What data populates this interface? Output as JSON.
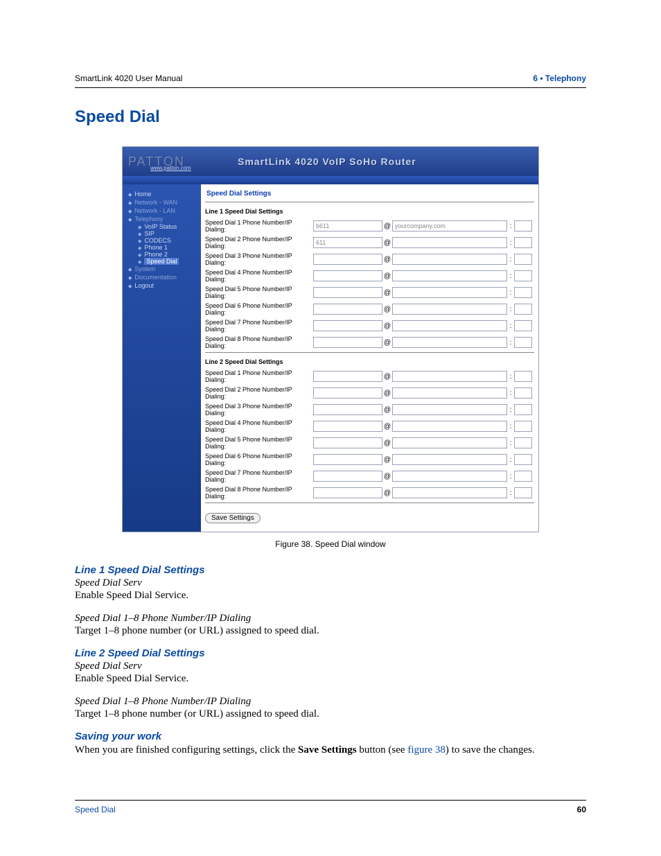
{
  "header": {
    "left": "SmartLink 4020 User Manual",
    "right": "6 • Telephony"
  },
  "page_title": "Speed Dial",
  "screenshot": {
    "brand": "PATTON",
    "brand_url": "www.patton.com",
    "banner_title": "SmartLink 4020 VoIP SoHo Router",
    "nav": {
      "home": "Home",
      "wan": "Network - WAN",
      "lan": "Network - LAN",
      "telephony": "Telephony",
      "voip_status": "VoIP Status",
      "sip": "SIP",
      "codecs": "CODECS",
      "phone1": "Phone 1",
      "phone2": "Phone 2",
      "speed_dial": "Speed Dial",
      "system": "System",
      "documentation": "Documentation",
      "logout": "Logout"
    },
    "panel_title": "Speed Dial Settings",
    "at": "@",
    "colon": ":",
    "line1": {
      "heading": "Line 1 Speed Dial Settings",
      "rows": [
        {
          "label": "Speed Dial 1 Phone Number/IP Dialing:",
          "v1": "b611",
          "v2": "yourcompany.com",
          "v3": ""
        },
        {
          "label": "Speed Dial 2 Phone Number/IP Dialing:",
          "v1": "611",
          "v2": "",
          "v3": ""
        },
        {
          "label": "Speed Dial 3 Phone Number/IP Dialing:",
          "v1": "",
          "v2": "",
          "v3": ""
        },
        {
          "label": "Speed Dial 4 Phone Number/IP Dialing:",
          "v1": "",
          "v2": "",
          "v3": ""
        },
        {
          "label": "Speed Dial 5 Phone Number/IP Dialing:",
          "v1": "",
          "v2": "",
          "v3": ""
        },
        {
          "label": "Speed Dial 6 Phone Number/IP Dialing:",
          "v1": "",
          "v2": "",
          "v3": ""
        },
        {
          "label": "Speed Dial 7 Phone Number/IP Dialing:",
          "v1": "",
          "v2": "",
          "v3": ""
        },
        {
          "label": "Speed Dial 8 Phone Number/IP Dialing:",
          "v1": "",
          "v2": "",
          "v3": ""
        }
      ]
    },
    "line2": {
      "heading": "Line 2 Speed Dial Settings",
      "rows": [
        {
          "label": "Speed Dial 1 Phone Number/IP Dialing:",
          "v1": "",
          "v2": "",
          "v3": ""
        },
        {
          "label": "Speed Dial 2 Phone Number/IP Dialing:",
          "v1": "",
          "v2": "",
          "v3": ""
        },
        {
          "label": "Speed Dial 3 Phone Number/IP Dialing:",
          "v1": "",
          "v2": "",
          "v3": ""
        },
        {
          "label": "Speed Dial 4 Phone Number/IP Dialing:",
          "v1": "",
          "v2": "",
          "v3": ""
        },
        {
          "label": "Speed Dial 5 Phone Number/IP Dialing:",
          "v1": "",
          "v2": "",
          "v3": ""
        },
        {
          "label": "Speed Dial 6 Phone Number/IP Dialing:",
          "v1": "",
          "v2": "",
          "v3": ""
        },
        {
          "label": "Speed Dial 7 Phone Number/IP Dialing:",
          "v1": "",
          "v2": "",
          "v3": ""
        },
        {
          "label": "Speed Dial 8 Phone Number/IP Dialing:",
          "v1": "",
          "v2": "",
          "v3": ""
        }
      ]
    },
    "save_label": "Save Settings"
  },
  "caption": "Figure 38. Speed Dial window",
  "sections": {
    "l1": {
      "h": "Line 1 Speed Dial Settings",
      "serv_h": "Speed Dial Serv",
      "serv_b": "Enable Speed Dial Service.",
      "num_h": "Speed Dial 1–8 Phone Number/IP Dialing",
      "num_b": "Target 1–8 phone number (or URL) assigned to speed dial."
    },
    "l2": {
      "h": "Line 2 Speed Dial Settings",
      "serv_h": "Speed Dial Serv",
      "serv_b": "Enable Speed Dial Service.",
      "num_h": "Speed Dial 1–8 Phone Number/IP Dialing",
      "num_b": "Target 1–8 phone number (or URL) assigned to speed dial."
    },
    "save": {
      "h": "Saving your work",
      "pre": "When you are finished configuring settings, click the ",
      "btn": "Save Settings",
      "mid": " button (see ",
      "ref": "figure 38",
      "post": ") to save the changes."
    }
  },
  "footer": {
    "left": "Speed Dial",
    "page": "60"
  }
}
